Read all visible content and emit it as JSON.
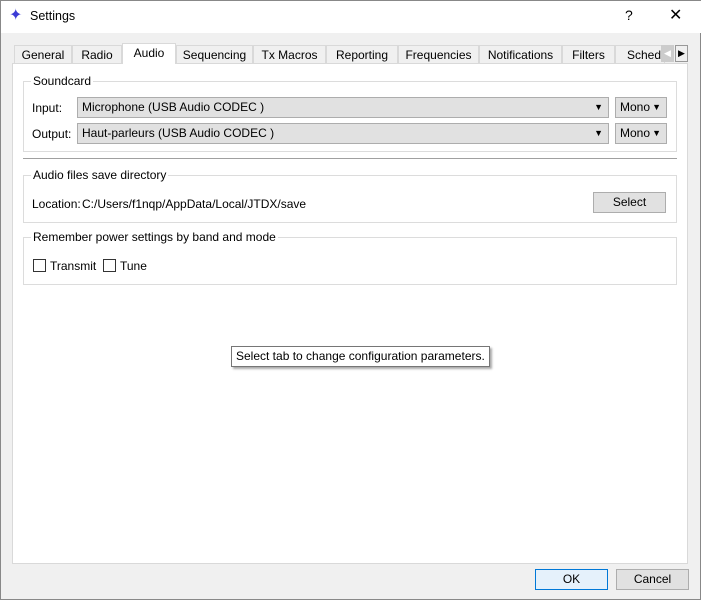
{
  "window": {
    "title": "Settings",
    "help": "?",
    "close": "✕"
  },
  "tabs": [
    {
      "label": "General"
    },
    {
      "label": "Radio"
    },
    {
      "label": "Audio",
      "selected": true
    },
    {
      "label": "Sequencing"
    },
    {
      "label": "Tx Macros"
    },
    {
      "label": "Reporting"
    },
    {
      "label": "Frequencies"
    },
    {
      "label": "Notifications"
    },
    {
      "label": "Filters"
    },
    {
      "label": "Schedu"
    }
  ],
  "soundcard": {
    "title": "Soundcard",
    "input_label": "Input:",
    "input_value": "Microphone (USB Audio CODEC )",
    "input_channel": "Mono",
    "output_label": "Output:",
    "output_value": "Haut-parleurs (USB Audio CODEC )",
    "output_channel": "Mono"
  },
  "save_dir": {
    "title": "Audio files save directory",
    "location_label": "Location:",
    "location_value": "C:/Users/f1nqp/AppData/Local/JTDX/save",
    "select_label": "Select"
  },
  "power": {
    "title": "Remember power settings by band and mode",
    "transmit_label": "Transmit",
    "transmit_checked": false,
    "tune_label": "Tune",
    "tune_checked": false
  },
  "tooltip": "Select tab to change configuration parameters.",
  "footer": {
    "ok": "OK",
    "cancel": "Cancel"
  }
}
